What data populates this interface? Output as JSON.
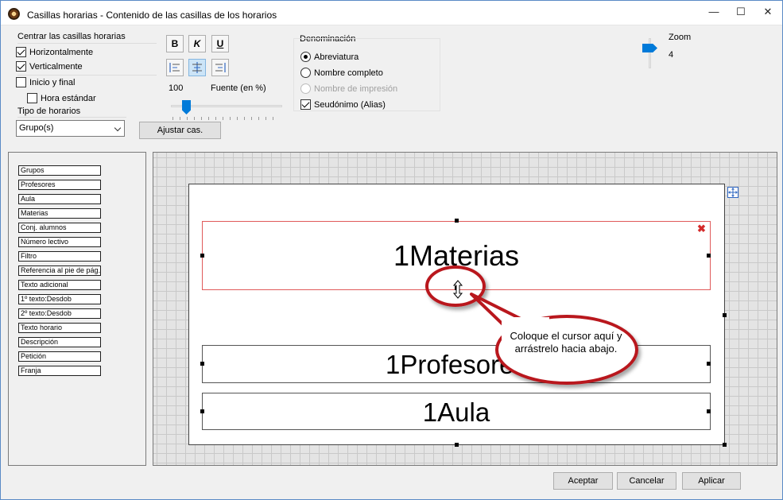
{
  "window": {
    "title": "Casillas horarias - Contenido de las casillas de los horarios",
    "minimize": "—",
    "maximize": "☐",
    "close": "✕"
  },
  "center_group": {
    "caption": "Centrar las casillas horarias",
    "horizontal": {
      "label": "Horizontalmente",
      "checked": true
    },
    "vertical": {
      "label": "Verticalmente",
      "checked": true
    },
    "start_end": {
      "label": "Inicio y final",
      "checked": false
    },
    "standard_time": {
      "label": "Hora estándar",
      "checked": false
    }
  },
  "schedule_type": {
    "caption": "Tipo de horarios",
    "selected": "Grupo(s)"
  },
  "formatting": {
    "bold": "B",
    "italic": "K",
    "underline": "U",
    "font_value": "100",
    "font_label": "Fuente (en %)",
    "fit_button": "Ajustar cas."
  },
  "denomination": {
    "caption": "Denominación",
    "options": [
      {
        "label": "Abreviatura",
        "checked": true,
        "disabled": false
      },
      {
        "label": "Nombre completo",
        "checked": false,
        "disabled": false
      },
      {
        "label": "Nombre de impresión",
        "checked": false,
        "disabled": true
      }
    ],
    "alias": {
      "label": "Seudónimo (Alias)",
      "checked": true
    }
  },
  "zoom": {
    "label": "Zoom",
    "value": "4"
  },
  "fields": [
    "Grupos",
    "Profesores",
    "Aula",
    "Materias",
    "Conj. alumnos",
    "Número lectivo",
    "Filtro",
    "Referencia al pie de pág.",
    "Texto adicional",
    "1º texto:Desdob",
    "2º texto:Desdob",
    "Texto horario",
    "Descripción",
    "Petición",
    "Franja"
  ],
  "cells": {
    "materias": "1Materias",
    "profesores": "1Profesores",
    "aula": "1Aula"
  },
  "callout": {
    "text": "Coloque el cursor aquí y arrástrelo hacia abajo."
  },
  "buttons": {
    "accept": "Aceptar",
    "cancel": "Cancelar",
    "apply": "Aplicar"
  },
  "colors": {
    "accent": "#007ad9",
    "callout_red": "#b9171d",
    "selected_box": "#e05a5a"
  }
}
